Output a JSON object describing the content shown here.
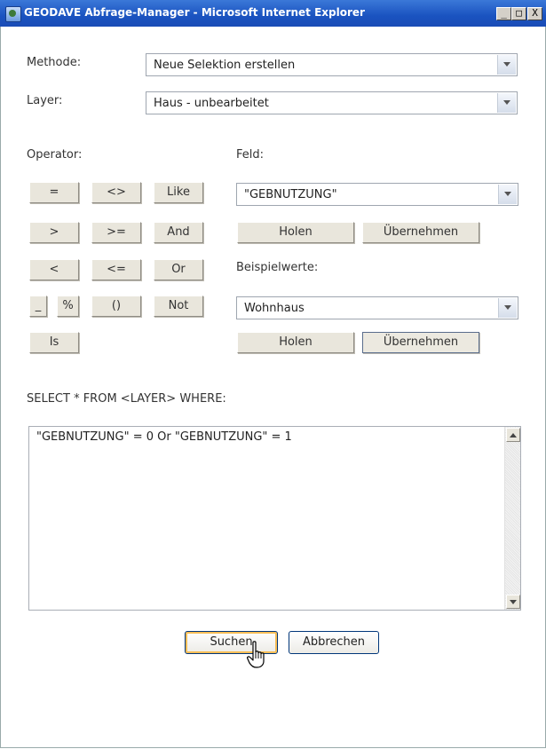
{
  "window": {
    "title": "GEODAVE Abfrage-Manager - Microsoft Internet Explorer",
    "controls": [
      "_",
      "□",
      "X"
    ]
  },
  "form": {
    "methode_label": "Methode:",
    "methode_value": "Neue Selektion erstellen",
    "layer_label": "Layer:",
    "layer_value": "Haus - unbearbeitet"
  },
  "operator": {
    "label": "Operator:",
    "buttons": [
      "=",
      "<>",
      "Like",
      ">",
      ">=",
      "And",
      "<",
      "<=",
      "Or",
      "_",
      "%",
      "()",
      "Not",
      "Is"
    ]
  },
  "feld": {
    "label": "Feld:",
    "value": "\"GEBNUTZUNG\"",
    "holen": "Holen",
    "uebernehmen": "Übernehmen"
  },
  "beispielwerte": {
    "label": "Beispielwerte:",
    "value": "Wohnhaus",
    "holen": "Holen",
    "uebernehmen": "Übernehmen"
  },
  "query": {
    "label": "SELECT * FROM <LAYER> WHERE:",
    "text": "\"GEBNUTZUNG\" = 0 Or \"GEBNUTZUNG\" = 1"
  },
  "actions": {
    "search": "Suchen",
    "cancel": "Abbrechen"
  }
}
